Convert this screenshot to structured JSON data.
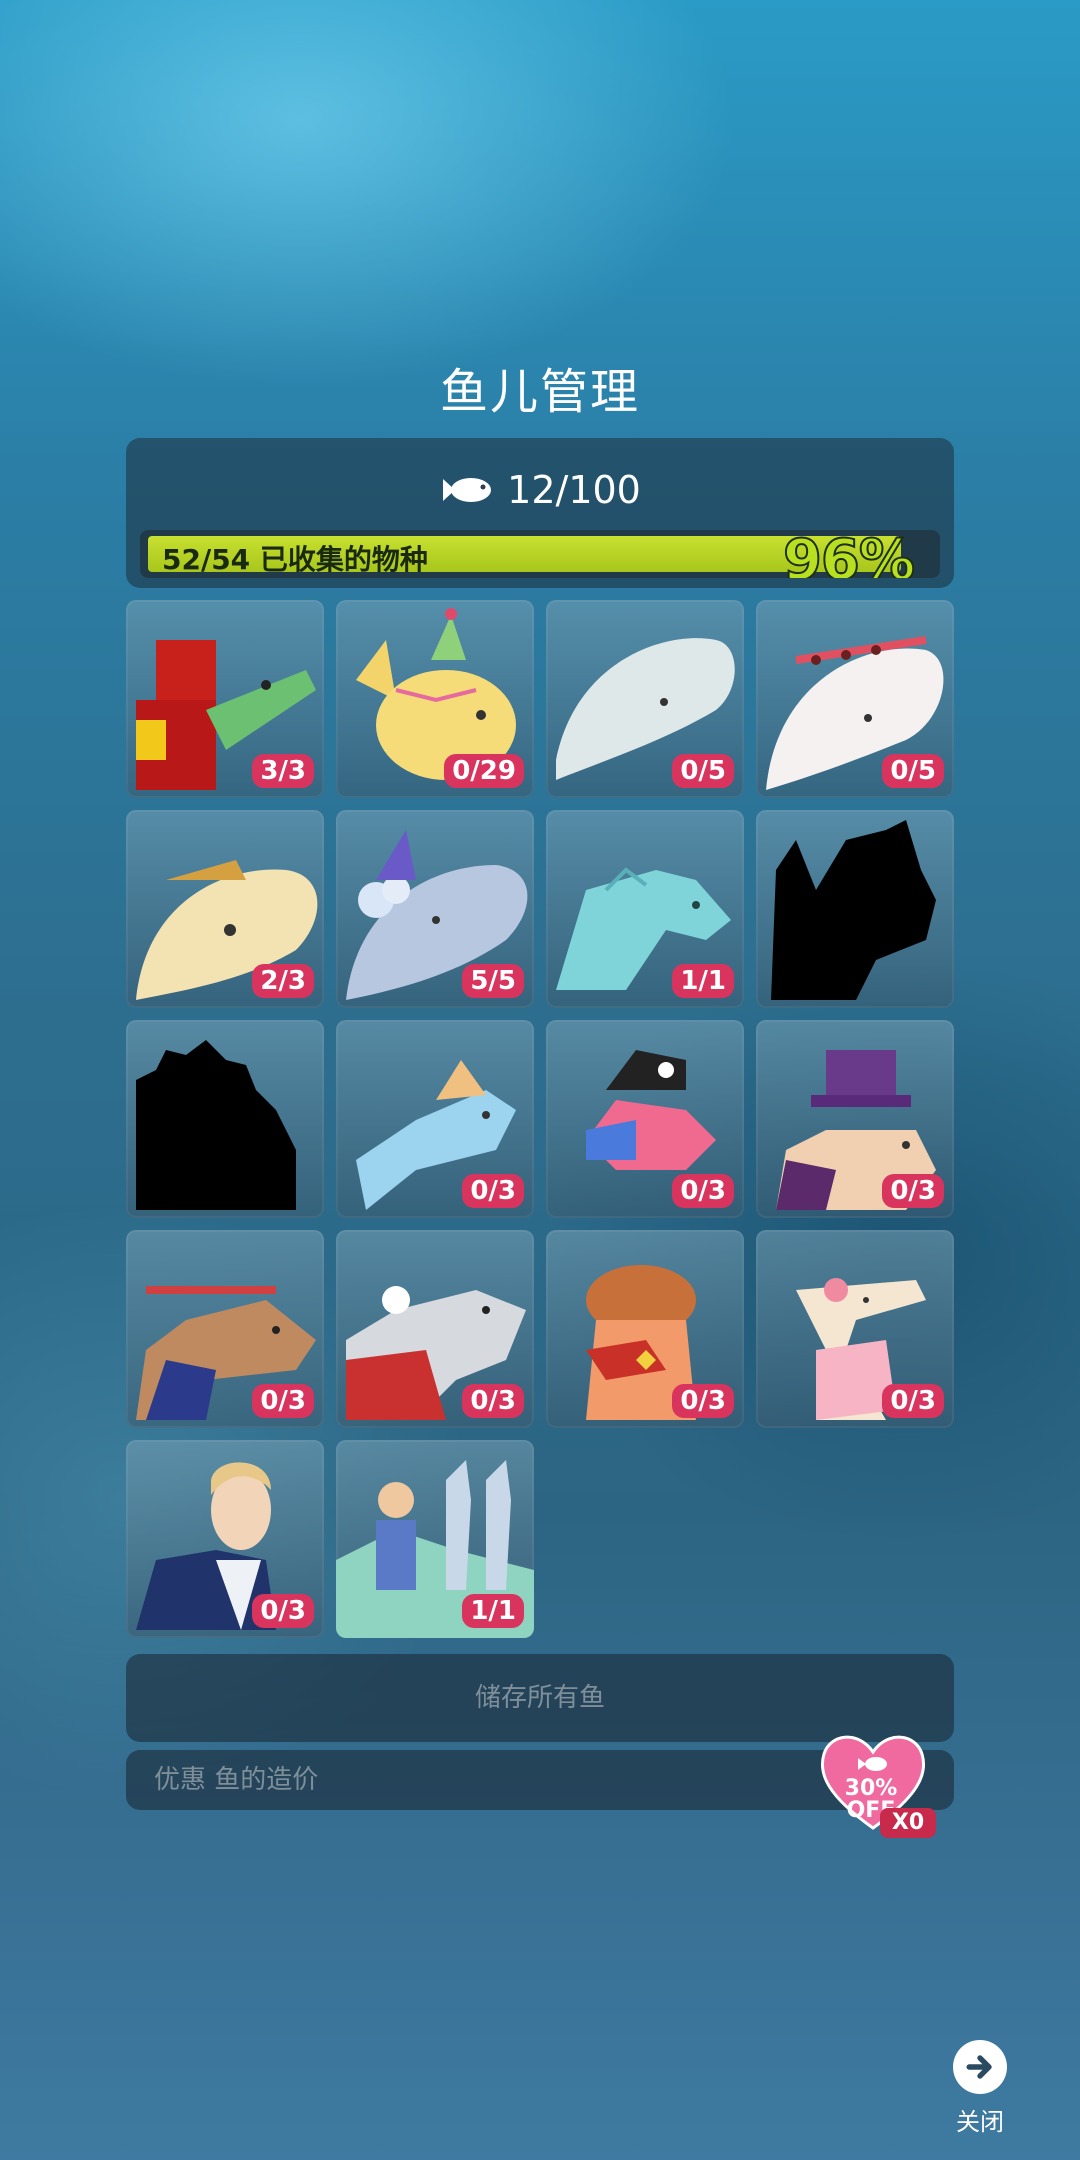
{
  "title": "鱼儿管理",
  "summary": {
    "fish_count": "12/100",
    "fish_icon": "fish-icon"
  },
  "progress": {
    "label": "52/54 已收集的物种",
    "percent_text": "96%",
    "percent": 0.96
  },
  "cards": [
    {
      "name": "crocodile-guard",
      "count": "3/3"
    },
    {
      "name": "party-sunfish",
      "count": "0/29"
    },
    {
      "name": "sperm-whale",
      "count": "0/5"
    },
    {
      "name": "cake-whale",
      "count": "0/5"
    },
    {
      "name": "golden-whale",
      "count": "2/3"
    },
    {
      "name": "party-blue-whale",
      "count": "5/5"
    },
    {
      "name": "aqua-dragon",
      "count": "1/1"
    },
    {
      "name": "locked-silhouette-1",
      "count": ""
    },
    {
      "name": "locked-silhouette-2",
      "count": ""
    },
    {
      "name": "hat-fish",
      "count": "0/3"
    },
    {
      "name": "pirate-fish",
      "count": "0/3"
    },
    {
      "name": "gentleman-walrus",
      "count": "0/3"
    },
    {
      "name": "otter-hero",
      "count": "0/3"
    },
    {
      "name": "festive-penguin",
      "count": "0/3"
    },
    {
      "name": "cowboy-fish",
      "count": "0/3"
    },
    {
      "name": "sakura-creature",
      "count": "0/3"
    },
    {
      "name": "elf-character",
      "count": "0/3"
    },
    {
      "name": "poseidon-seahorses",
      "count": "1/1"
    }
  ],
  "store_button": "储存所有鱼",
  "discount": {
    "label": "优惠 鱼的造价",
    "badge_percent": "30%",
    "badge_off": "OFF",
    "badge_multiplier": "X0"
  },
  "close": {
    "label": "关闭",
    "icon": "arrow-right-icon"
  }
}
